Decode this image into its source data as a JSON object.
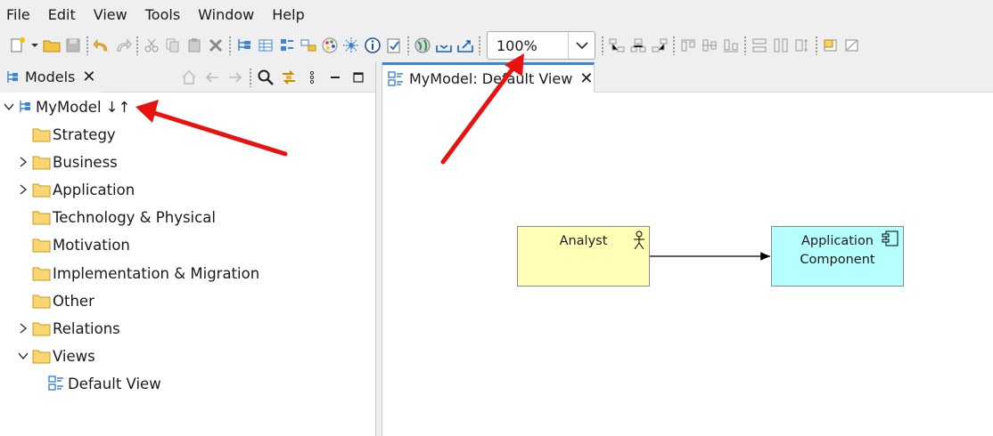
{
  "menubar": {
    "items": [
      "File",
      "Edit",
      "View",
      "Tools",
      "Window",
      "Help"
    ]
  },
  "toolbar": {
    "zoom": "100%"
  },
  "models_panel": {
    "tab_title": "Models",
    "tree": {
      "root": {
        "label": "MyModel ↓↑"
      },
      "items": [
        {
          "label": "Strategy",
          "expandable": false
        },
        {
          "label": "Business",
          "expandable": true
        },
        {
          "label": "Application",
          "expandable": true
        },
        {
          "label": "Technology & Physical",
          "expandable": false
        },
        {
          "label": "Motivation",
          "expandable": false
        },
        {
          "label": "Implementation & Migration",
          "expandable": false
        },
        {
          "label": "Other",
          "expandable": false
        },
        {
          "label": "Relations",
          "expandable": true
        },
        {
          "label": "Views",
          "expanded": true
        }
      ],
      "view_item": {
        "label": "Default View"
      }
    }
  },
  "editor": {
    "tab_title": "MyModel: Default View",
    "diagram": {
      "actor": {
        "label": "Analyst",
        "color": "#ffffb5"
      },
      "component": {
        "label_line1": "Application",
        "label_line2": "Component",
        "color": "#b5ffff"
      }
    }
  },
  "colors": {
    "accent": "#3c84d6",
    "annotation_arrow": "#e8130f"
  }
}
